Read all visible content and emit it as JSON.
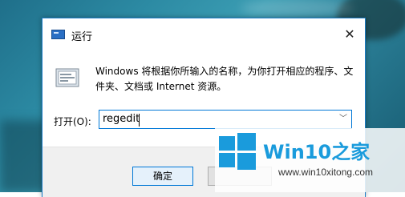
{
  "dialog": {
    "title": "运行",
    "close_glyph": "✕",
    "description": "Windows 将根据你所输入的名称，为你打开相应的程序、文件夹、文档或 Internet 资源。",
    "open_label": "打开(O):",
    "open_value": "regedit",
    "dropdown_glyph": "﹀",
    "ok_label": "确定"
  },
  "watermark": {
    "title_latin": "Win10",
    "title_cjk": "之家",
    "url": "www.win10xitong.com"
  },
  "colors": {
    "accent": "#0078d7",
    "watermark_blue": "#1a9bdc",
    "desktop": "#2c8aa3"
  },
  "icons": {
    "title": "run-app-icon",
    "run": "run-program-icon",
    "close": "close-icon",
    "dropdown": "chevron-down-icon",
    "watermark": "windows-logo-icon"
  }
}
